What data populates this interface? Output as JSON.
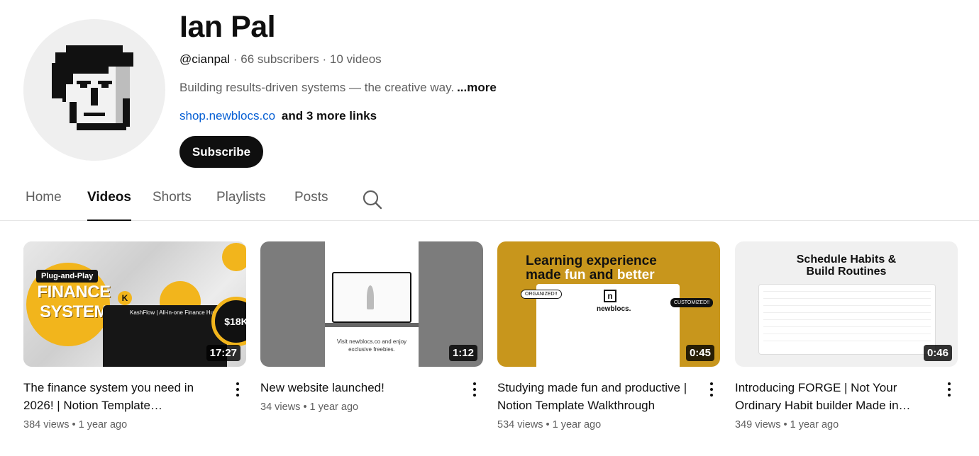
{
  "channel": {
    "name": "Ian Pal",
    "handle": "@cianpal",
    "stats": " · 66 subscribers · 10 videos",
    "description": "Building results-driven systems — the creative way.",
    "more_label": "...more",
    "link_text": "shop.newblocs.co",
    "more_links": "and 3 more links",
    "subscribe_label": "Subscribe"
  },
  "tabs": [
    {
      "label": "Home",
      "active": false
    },
    {
      "label": "Videos",
      "active": true
    },
    {
      "label": "Shorts",
      "active": false
    },
    {
      "label": "Playlists",
      "active": false
    },
    {
      "label": "Posts",
      "active": false
    }
  ],
  "videos": [
    {
      "title": "The finance system you need in 2026! | Notion Template…",
      "views": "384 views",
      "age": "1 year ago",
      "meta": "384 views • 1 year ago",
      "duration": "17:27",
      "thumb": {
        "label1": "Plug-and-Play",
        "label2": "FINANCE SYSTEM",
        "label3": "KashFlow | All-in-one Finance Hub",
        "amount": "$18K",
        "logo": "K"
      }
    },
    {
      "title": "New website launched!",
      "views": "34 views",
      "age": "1 year ago",
      "meta": "34 views • 1 year ago",
      "duration": "1:12",
      "thumb": {
        "caption": "Visit newblocs.co and enjoy exclusive freebies."
      }
    },
    {
      "title": "Studying made fun and productive | Notion Template Walkthrough",
      "views": "534 views",
      "age": "1 year ago",
      "meta": "534 views • 1 year ago",
      "duration": "0:45",
      "thumb": {
        "headline_a": "Learning experience",
        "headline_b": "made ",
        "headline_fun": "fun",
        "headline_c": " and ",
        "headline_better": "better",
        "brand": "newblocs.",
        "tag1": "ORGANIZED!!",
        "tag2": "CUSTOMIZED!!",
        "logo": "n"
      }
    },
    {
      "title": "Introducing FORGE | Not Your Ordinary Habit builder Made in…",
      "views": "349 views",
      "age": "1 year ago",
      "meta": "349 views • 1 year ago",
      "duration": "0:46",
      "thumb": {
        "headline_a": "Schedule Habits &",
        "headline_b": "Build Routines"
      }
    }
  ],
  "icons": {
    "search": "search-icon",
    "more": "more-vert-icon"
  },
  "colors": {
    "accent_link": "#065fd4",
    "button": "#0f0f0f",
    "thumb_gold": "#f2b51c"
  }
}
